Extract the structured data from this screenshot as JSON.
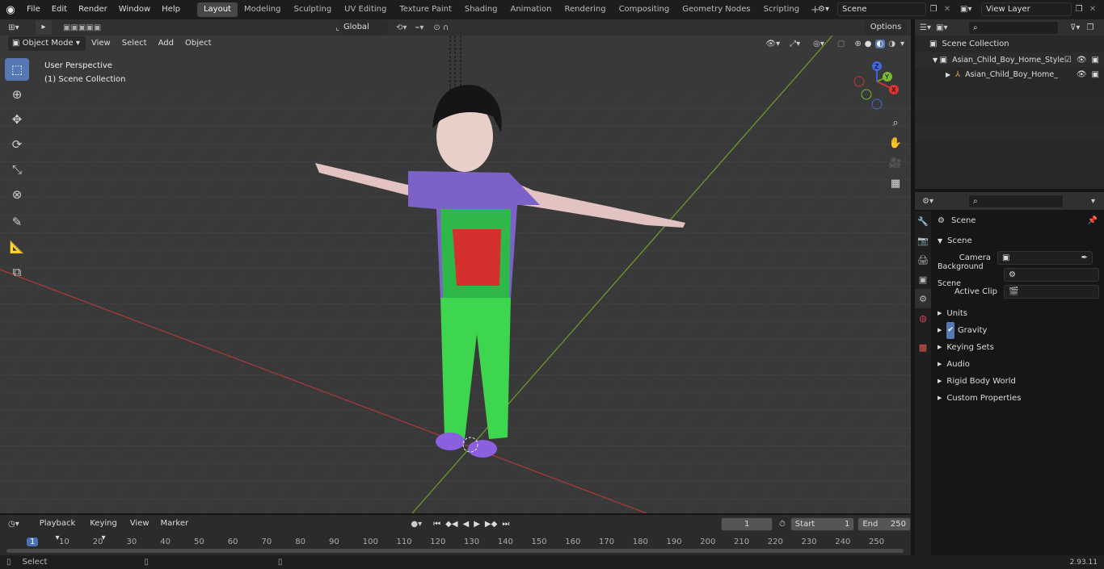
{
  "topbar": {
    "menus": [
      "File",
      "Edit",
      "Render",
      "Window",
      "Help"
    ],
    "workspaces": [
      "Layout",
      "Modeling",
      "Sculpting",
      "UV Editing",
      "Texture Paint",
      "Shading",
      "Animation",
      "Rendering",
      "Compositing",
      "Geometry Nodes",
      "Scripting"
    ],
    "active_workspace": "Layout",
    "scene": "Scene",
    "view_layer": "View Layer"
  },
  "viewport": {
    "options_label": "Options",
    "transform_orientation": "Global",
    "mode": "Object Mode",
    "menus": [
      "View",
      "Select",
      "Add",
      "Object"
    ],
    "perspective": "User Perspective",
    "collection": "(1) Scene Collection",
    "gizmo_axes": [
      "X",
      "Y",
      "Z"
    ]
  },
  "outliner": {
    "root": "Scene Collection",
    "items": [
      "Asian_Child_Boy_Home_Style",
      "Asian_Child_Boy_Home_"
    ]
  },
  "properties": {
    "context": "Scene",
    "section": "Scene",
    "fields": [
      {
        "label": "Camera"
      },
      {
        "label": "Background Scene"
      },
      {
        "label": "Active Clip"
      }
    ],
    "panels": [
      "Units",
      "Gravity",
      "Keying Sets",
      "Audio",
      "Rigid Body World",
      "Custom Properties"
    ],
    "gravity_checked": true
  },
  "timeline": {
    "menus": [
      "Playback",
      "Keying",
      "View",
      "Marker"
    ],
    "current_frame": "1",
    "start_label": "Start",
    "start": "1",
    "end_label": "End",
    "end": "250",
    "ticks": [
      "1",
      "10",
      "20",
      "30",
      "40",
      "50",
      "60",
      "70",
      "80",
      "90",
      "100",
      "110",
      "120",
      "130",
      "140",
      "150",
      "160",
      "170",
      "180",
      "190",
      "200",
      "210",
      "220",
      "230",
      "240",
      "250"
    ]
  },
  "status": {
    "select_label": "Select",
    "version": "2.93.11"
  }
}
